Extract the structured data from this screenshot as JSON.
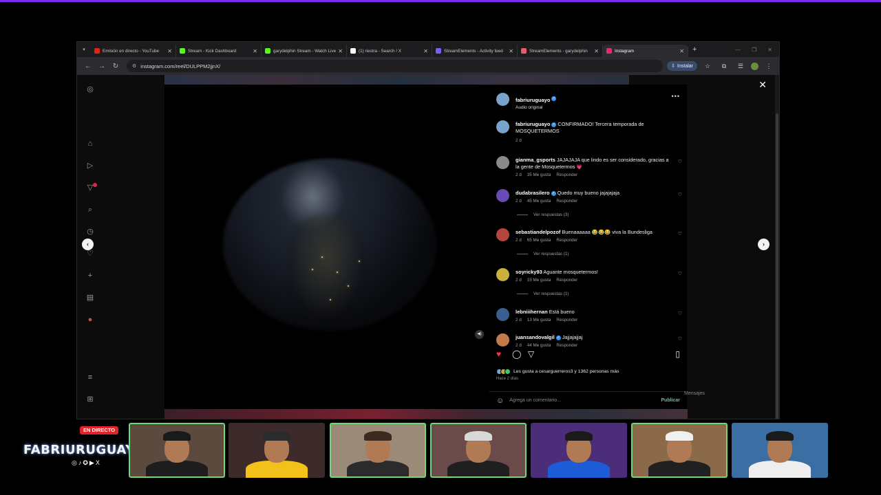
{
  "browser": {
    "tabs": [
      {
        "label": "Emisión en directo - YouTube",
        "favicon": "youtube-icon",
        "color": "#e62117",
        "active": false
      },
      {
        "label": "Stream - Kick Dashboard",
        "favicon": "kick-icon",
        "color": "#53fc18",
        "active": false
      },
      {
        "label": "garydelphin Stream - Watch Live",
        "favicon": "kick-icon",
        "color": "#53fc18",
        "active": false
      },
      {
        "label": "(1) riestra - Search / X",
        "favicon": "x-icon",
        "color": "#ffffff",
        "active": false
      },
      {
        "label": "StreamElements - Activity feed",
        "favicon": "streamelements-icon",
        "color": "#7b5cff",
        "active": false
      },
      {
        "label": "StreamElements - garydelphin",
        "favicon": "streamelements-icon",
        "color": "#e85c6a",
        "active": false
      },
      {
        "label": "Instagram",
        "favicon": "instagram-icon",
        "color": "#e1306c",
        "active": true
      }
    ],
    "url": "instagram.com/reel/DULPPM2jjnX/",
    "install_label": "Instalar"
  },
  "reel": {
    "author": "fabriuruguayo",
    "audio": "Audio original",
    "caption_user": "fabriuruguayo",
    "caption": "CONFIRMADO! Tercera temporada de MOSQUETERMOS",
    "caption_time": "2 d",
    "comments": [
      {
        "user": "gianma_gsports",
        "verified": false,
        "text": "JAJAJAJA que lindo es ser considerado, gracias a la gente de Mosquetermos 💗",
        "time": "2 d",
        "likes": "35 Me gusta",
        "reply": "Responder",
        "replies": "",
        "avatar": "#8a8a8a"
      },
      {
        "user": "dudabrasilero",
        "verified": true,
        "text": "Quedo muy bueno jajajajaja",
        "time": "2 d",
        "likes": "45 Me gusta",
        "reply": "Responder",
        "replies": "Ver respuestas (3)",
        "avatar": "#6a4bb5"
      },
      {
        "user": "sebastiandelpozof",
        "verified": false,
        "text": "Buenaaaaaa 😂😂😂 viva la Bundesliga",
        "time": "2 d",
        "likes": "65 Me gusta",
        "reply": "Responder",
        "replies": "Ver respuestas (1)",
        "avatar": "#b5443a"
      },
      {
        "user": "soyricky93",
        "verified": false,
        "text": "Aguante mosquetermos!",
        "time": "2 d",
        "likes": "15 Me gusta",
        "reply": "Responder",
        "replies": "Ver respuestas (1)",
        "avatar": "#c9b23a"
      },
      {
        "user": "lebniiihernan",
        "verified": false,
        "text": "Está bueno",
        "time": "2 d",
        "likes": "13 Me gusta",
        "reply": "Responder",
        "replies": "",
        "avatar": "#3a5f8f"
      },
      {
        "user": "juansandovalgil",
        "verified": true,
        "text": "Jajjajajjaj",
        "time": "2 d",
        "likes": "44 Me gusta",
        "reply": "Responder",
        "replies": "",
        "avatar": "#c47b4a"
      }
    ],
    "likes_text": "Les gusta a cesarguerreros3 y 1362 personas más",
    "posted": "Hace 2 días",
    "comment_placeholder": "Agrega un comentario...",
    "publish_label": "Publicar",
    "messages_label": "Mensajes"
  },
  "overlay": {
    "live_label": "EN DIRECTO",
    "brand": "FABRIURUGUAYO",
    "socials": "◎♪✪▶X"
  },
  "cams": [
    {
      "shirt": "#1d1d1d",
      "hat": "#1a1a1a",
      "bg": "#5c4a3e",
      "border": true
    },
    {
      "shirt": "#f3c21a",
      "hat": "#2b2b2b",
      "bg": "#3d2b2b",
      "border": false
    },
    {
      "shirt": "#2b2b2b",
      "hat": "#3a2a20",
      "bg": "#9b8a78",
      "border": true
    },
    {
      "shirt": "#1f1f1f",
      "hat": "#d9d9d9",
      "bg": "#6b4a4a",
      "border": true
    },
    {
      "shirt": "#1e5bd6",
      "hat": "#1a1a1a",
      "bg": "#4b2d7a",
      "border": false
    },
    {
      "shirt": "#202020",
      "hat": "#f0f0f0",
      "bg": "#8a6a48",
      "border": true
    },
    {
      "shirt": "#eeeeee",
      "hat": "#1a1a1a",
      "bg": "#3b6fa3",
      "border": false
    }
  ]
}
